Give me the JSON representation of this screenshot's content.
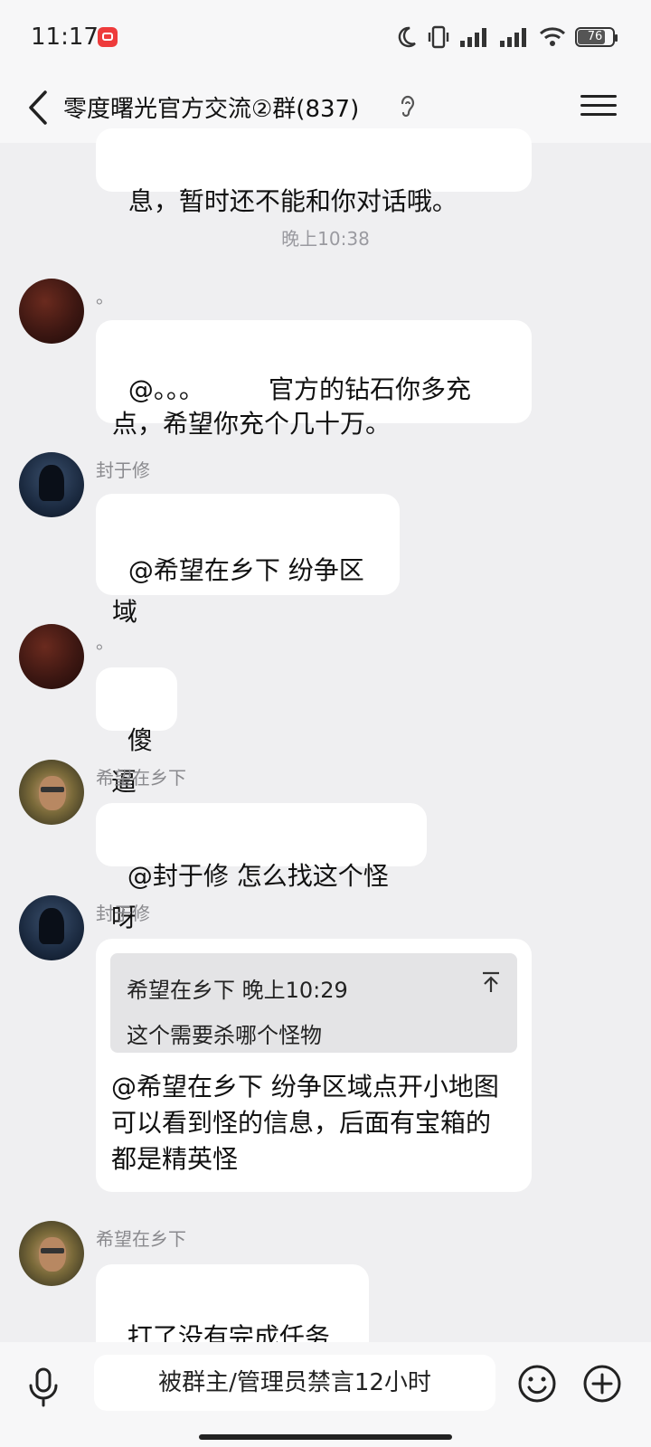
{
  "status_bar": {
    "time": "11:17",
    "battery": "76"
  },
  "header": {
    "title": "零度曙光官方交流②群(837)"
  },
  "messages": {
    "m0": {
      "text": "息，暂时还不能和你对话哦。"
    },
    "timestamp": "晚上10:38",
    "m1": {
      "sender": "。",
      "text": "@。。。        官方的钻石你多充\n点，希望你充个几十万。"
    },
    "m2": {
      "sender": "封于修",
      "text": "@希望在乡下 纷争区域"
    },
    "m3": {
      "sender": "。",
      "text": "傻逼"
    },
    "m4": {
      "sender": "希望在乡下",
      "text": "@封于修 怎么找这个怪呀"
    },
    "m5": {
      "sender": "封于修",
      "quote_header": "希望在乡下 晚上10:29",
      "quote_text": "这个需要杀哪个怪物",
      "text": "@希望在乡下 纷争区域点开小地图\n可以看到怪的信息，后面有宝箱的\n都是精英怪"
    },
    "m6": {
      "sender": "希望在乡下",
      "text": "打了没有完成任务呀"
    }
  },
  "input_bar": {
    "placeholder": "被群主/管理员禁言12小时"
  },
  "icons": [
    "back-icon",
    "menu-icon",
    "ear-icon",
    "mic-icon",
    "emoji-icon",
    "plus-icon",
    "moon-icon",
    "vibrate-icon",
    "signal-icon",
    "wifi-icon",
    "battery-icon"
  ]
}
